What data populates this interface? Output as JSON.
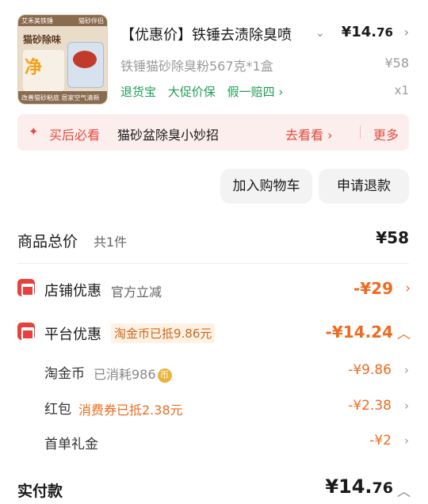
{
  "product": {
    "image_top_left": "艾禾美铁锤",
    "image_top_right": "猫砂伴侣",
    "image_title": "猫砂除味",
    "image_big_char": "净",
    "image_bottom_text": "改善猫砂粘底 居家空气清新",
    "title": "【优惠价】铁锤去渍除臭喷",
    "price_int": "¥14.",
    "price_dec": "76",
    "spec": "铁锤猫砂除臭粉567克*1盒",
    "original_price": "¥58",
    "tags": [
      "退货宝",
      "大促价保",
      "假一赔四 ›"
    ],
    "quantity": "x1"
  },
  "tip": {
    "label": "买后必看",
    "text": "猫砂盆除臭小妙招",
    "go": "去看看 ›",
    "more": "更多"
  },
  "buttons": {
    "cart": "加入购物车",
    "refund": "申请退款"
  },
  "totals": {
    "goods_label": "商品总价",
    "goods_count": "共1件",
    "goods_value": "¥58",
    "shop_label": "店铺优惠",
    "shop_sub": "官方立减",
    "shop_value": "-¥29",
    "platform_label": "平台优惠",
    "platform_badge": "淘金币已抵9.86元",
    "platform_value": "-¥14.24",
    "taojinbi_label": "淘金币",
    "taojinbi_sub": "已消耗986",
    "taojinbi_value": "-¥9.86",
    "hongbao_label": "红包",
    "hongbao_badge": "消费券已抵2.38元",
    "hongbao_value": "-¥2.38",
    "first_label": "首单礼金",
    "first_value": "-¥2",
    "paid_label": "实付款",
    "paid_int": "¥14.",
    "paid_dec": "76"
  }
}
